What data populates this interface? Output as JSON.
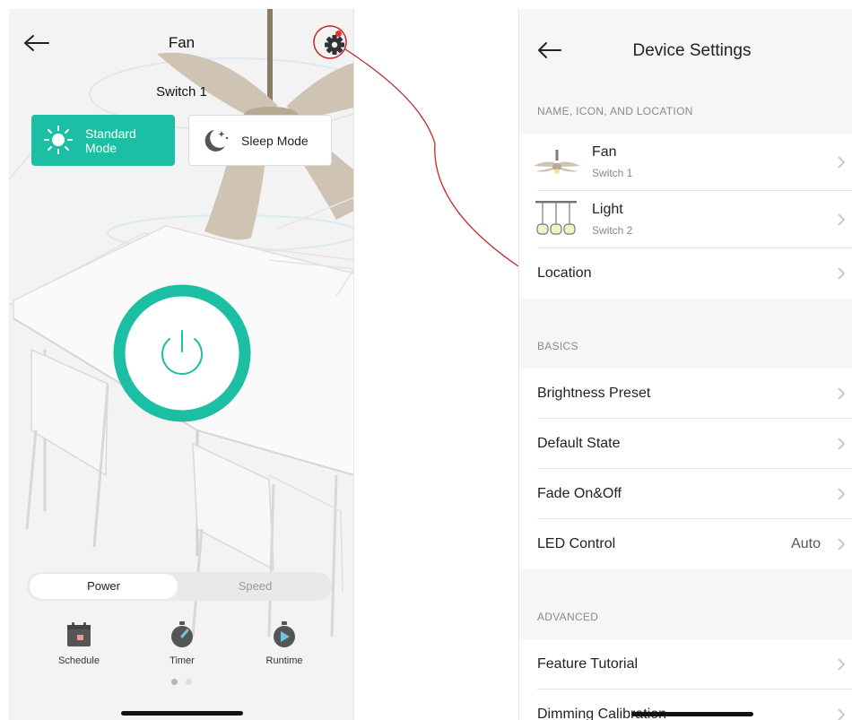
{
  "fan_screen": {
    "title": "Fan",
    "subtitle": "Switch 1",
    "modes": [
      {
        "line1": "Standard",
        "line2": "Mode",
        "active": true
      },
      {
        "label": "Sleep Mode",
        "active": false
      }
    ],
    "segment": {
      "power_label": "Power",
      "speed_label": "Speed",
      "selected": "Power"
    },
    "tools": [
      {
        "label": "Schedule",
        "icon": "calendar-icon"
      },
      {
        "label": "Timer",
        "icon": "stopwatch-icon"
      },
      {
        "label": "Runtime",
        "icon": "runtime-icon"
      }
    ],
    "pager": {
      "pages": 2,
      "current": 1
    },
    "colors": {
      "accent": "#1cbfa3",
      "notification_dot": "#e5322b",
      "callout": "#c0262b"
    }
  },
  "settings_screen": {
    "title": "Device Settings",
    "sections": [
      {
        "header": "NAME, ICON, AND LOCATION",
        "rows": [
          {
            "label": "Fan",
            "sublabel": "Switch 1",
            "icon": "ceiling-fan-icon"
          },
          {
            "label": "Light",
            "sublabel": "Switch 2",
            "icon": "pendant-light-icon"
          },
          {
            "label": "Location"
          }
        ]
      },
      {
        "header": "BASICS",
        "rows": [
          {
            "label": "Brightness Preset"
          },
          {
            "label": "Default State"
          },
          {
            "label": "Fade On&Off"
          },
          {
            "label": "LED Control",
            "value": "Auto"
          }
        ]
      },
      {
        "header": "ADVANCED",
        "rows": [
          {
            "label": "Feature Tutorial"
          },
          {
            "label": "Dimming Calibration"
          }
        ]
      }
    ]
  }
}
